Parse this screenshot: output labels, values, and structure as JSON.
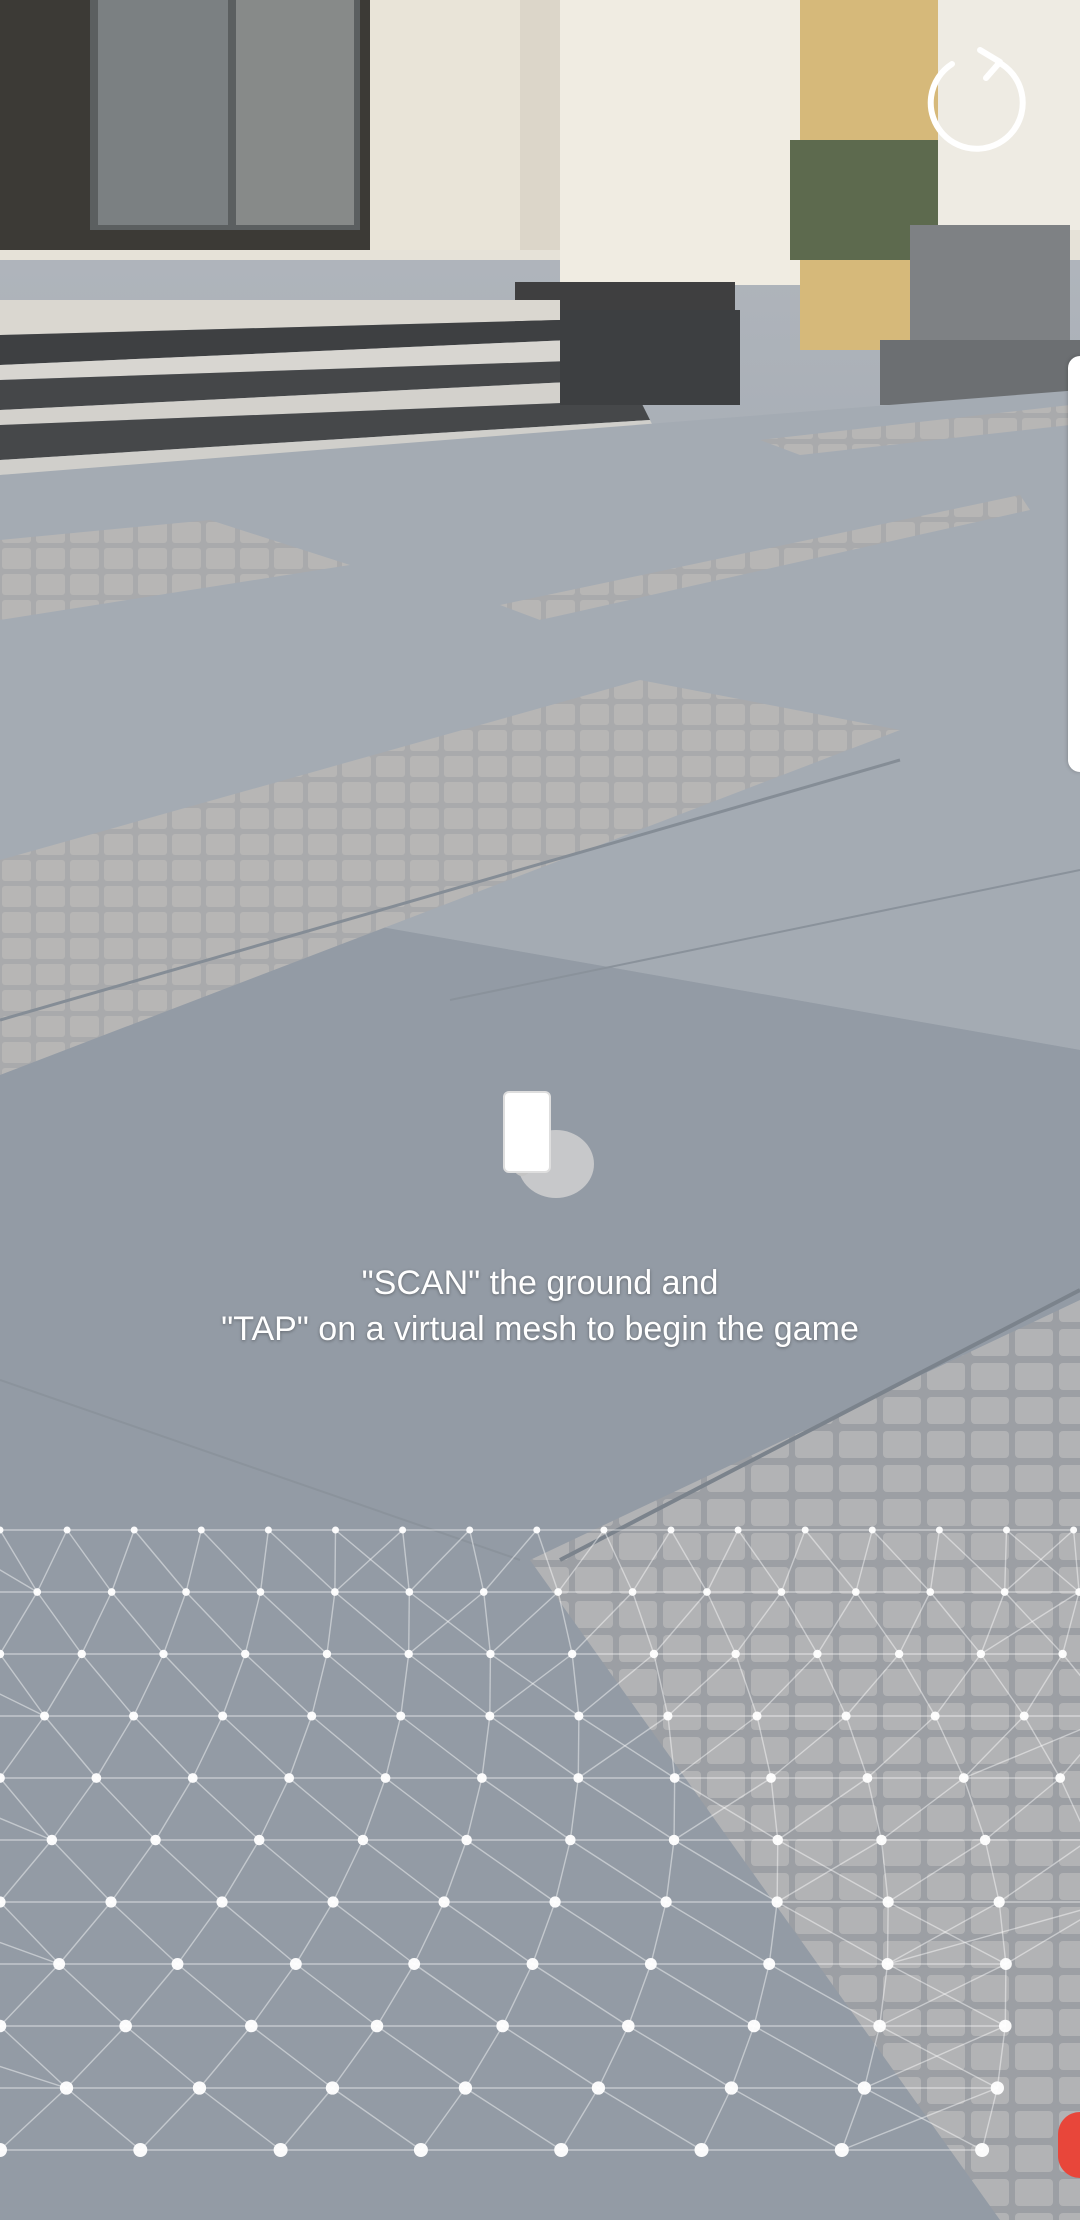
{
  "instruction": {
    "line1": "\"SCAN\" the ground and",
    "line2": "\"TAP\" on a virtual mesh to begin the game"
  },
  "controls": {
    "refresh_icon": "refresh-icon",
    "hint_icon": "hand-holding-phone-icon"
  },
  "colors": {
    "text": "#ffffff",
    "mesh_dot": "#ffffff",
    "corner_indicator": "#e8463a"
  }
}
